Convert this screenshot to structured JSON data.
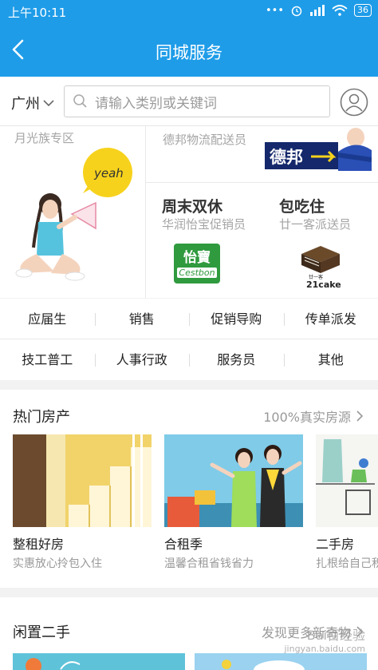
{
  "status_bar": {
    "time": "上午10:11",
    "battery": "36",
    "dots": "•••"
  },
  "header": {
    "title": "同城服务"
  },
  "search": {
    "city": "广州",
    "placeholder": "请输入类别或关键词"
  },
  "banner": {
    "left_label": "月光族专区",
    "left_bubble": "yeah",
    "top_right_label": "德邦物流配送员",
    "top_right_logo": "德邦",
    "promo1_title": "周末双休",
    "promo1_sub": "华润怡宝促销员",
    "promo1_logo_cn": "怡寶",
    "promo1_logo_en": "Cestbon",
    "promo2_title": "包吃住",
    "promo2_sub": "廿一客派送员",
    "promo2_logo": "21cake",
    "promo2_logo_cn": "廿一客"
  },
  "categories": {
    "row1": [
      "应届生",
      "销售",
      "促销导购",
      "传单派发"
    ],
    "row2": [
      "技工普工",
      "人事行政",
      "服务员",
      "其他"
    ]
  },
  "hot_property": {
    "title": "热门房产",
    "more": "100%真实房源",
    "cards": [
      {
        "title": "整租好房",
        "sub": "实惠放心拎包入住"
      },
      {
        "title": "合租季",
        "sub": "温馨合租省钱省力"
      },
      {
        "title": "二手房",
        "sub": "扎根给自己积"
      }
    ]
  },
  "second_hand": {
    "title": "闲置二手",
    "more": "发现更多新奇物"
  },
  "watermark": {
    "line1": "Bai百经验",
    "line2": "jingyan.baidu.com"
  },
  "colors": {
    "primary": "#1e9ce8",
    "yellow": "#f7d21c",
    "green": "#2f9a3e"
  }
}
